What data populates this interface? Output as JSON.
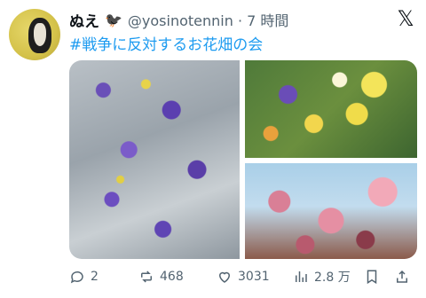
{
  "post": {
    "author_name": "ぬえ",
    "author_emoji": "🐦‍⬛",
    "handle_time": "@yosinotennin · 7 時間",
    "close_label": "𝕏",
    "text": "#戦争に反対するお花畑の会"
  },
  "media": {
    "images": [
      {
        "name": "purple-sage-flowers"
      },
      {
        "name": "pansies-and-yellow-flowers"
      },
      {
        "name": "pink-dogwood-blossoms"
      }
    ]
  },
  "actions": {
    "reply_count": "2",
    "repost_count": "468",
    "like_count": "3031",
    "view_count": "2.8 万"
  },
  "colors": {
    "link": "#1d9bf0",
    "muted": "#536471",
    "text": "#0f1419"
  },
  "icons": {
    "reply": "speech-bubble-icon",
    "repost": "repost-icon",
    "like": "heart-icon",
    "views": "bar-chart-icon",
    "bookmark": "bookmark-icon",
    "share": "share-icon",
    "close": "x-logo-icon"
  }
}
